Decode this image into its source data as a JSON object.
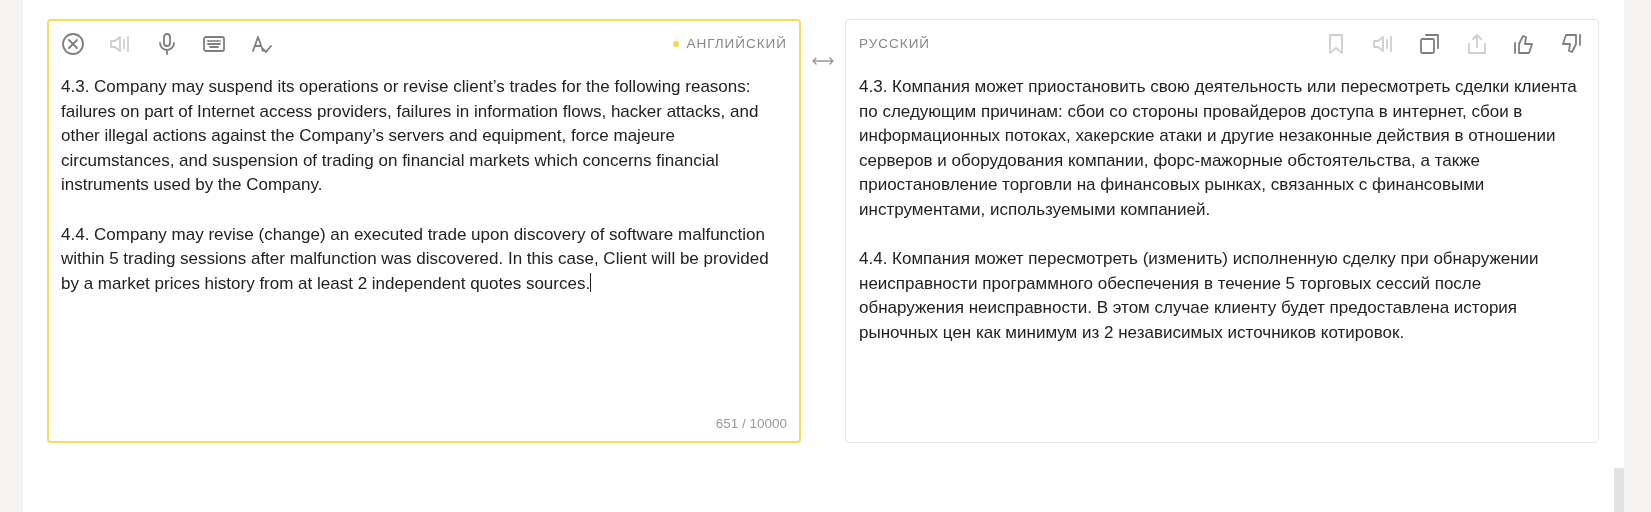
{
  "source": {
    "tools": [
      {
        "kind": "clear",
        "disabled": false
      },
      {
        "kind": "speaker",
        "disabled": true
      },
      {
        "kind": "microphone",
        "disabled": false
      },
      {
        "kind": "keyboard",
        "disabled": false
      },
      {
        "kind": "spellcheck",
        "disabled": false
      }
    ],
    "language": "АНГЛИЙСКИЙ",
    "paragraphs": [
      "4.3. Company may suspend its operations or revise client’s trades for the following reasons: failures on part of Internet access providers, failures in information flows, hacker attacks, and other illegal actions against the Company’s servers and equipment, force majeure circumstances, and suspension of trading on financial markets which concerns financial instruments used by the Company.",
      "4.4. Company may revise (change) an executed trade upon discovery of software malfunction within 5 trading sessions after malfunction was discovered. In this case, Client will be provided by a market prices history from at least 2 independent quotes sources."
    ],
    "counter": "651 / 10000"
  },
  "target": {
    "language": "РУССКИЙ",
    "tools": [
      {
        "kind": "bookmark",
        "disabled": true
      },
      {
        "kind": "speaker",
        "disabled": true
      },
      {
        "kind": "copy",
        "disabled": false
      },
      {
        "kind": "share",
        "disabled": true
      },
      {
        "kind": "thumbs-up",
        "disabled": false
      },
      {
        "kind": "thumbs-down",
        "disabled": false
      }
    ],
    "paragraphs": [
      "4.3. Компания может приостановить свою деятельность или пересмотреть сделки клиента по следующим причинам: сбои со стороны провайдеров доступа в интернет, сбои в информационных потоках, хакерские атаки и другие незаконные действия в отношении серверов и оборудования компании, форс-мажорные обстоятельства, а также приостановление торговли на финансовых рынках, связанных с финансовыми инструментами, используемыми компанией.",
      "4.4. Компания может пересмотреть (изменить) исполненную сделку при обнаружении неисправности программного обеспечения в течение 5 торговых сессий после обнаружения неисправности. В этом случае клиенту будет предоставлена история рыночных цен как минимум из 2 независимых источников котировок."
    ]
  }
}
